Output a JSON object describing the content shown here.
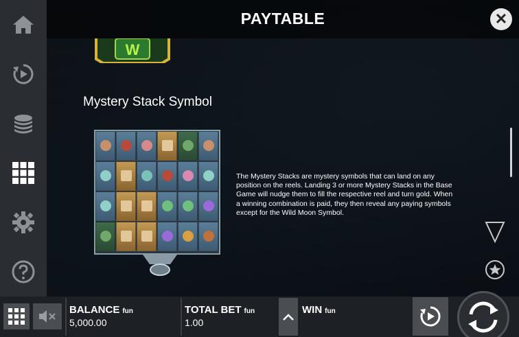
{
  "header": {
    "title": "PAYTABLE"
  },
  "section": {
    "title": "Mystery Stack Symbol",
    "description": "The Mystery Stacks are mystery symbols that can land on any position on the reels. Landing 3 or more Mystery Stacks in the Base Game will nudge them to fill the respective reel and turn gold. When a winning combination is paid, they then reveal any paying symbols except for the Wild Moon Symbol."
  },
  "wild_badge": {
    "letter": "W"
  },
  "sidebar": {
    "items": [
      {
        "icon": "home-icon"
      },
      {
        "icon": "replay-icon"
      },
      {
        "icon": "coins-icon"
      },
      {
        "icon": "grid-icon",
        "active": true
      },
      {
        "icon": "gear-icon"
      },
      {
        "icon": "help-icon"
      }
    ]
  },
  "bottom_bar": {
    "balance_label": "BALANCE",
    "balance_fun": "fun",
    "balance_value": "5,000.00",
    "total_bet_label": "TOTAL BET",
    "total_bet_fun": "fun",
    "total_bet_value": "1.00",
    "win_label": "WIN",
    "win_fun": "fun"
  },
  "colors": {
    "accent_gold": "#c39a55",
    "sidebar_bg": "#2a2d31",
    "bottom_bg": "#1d2024"
  }
}
